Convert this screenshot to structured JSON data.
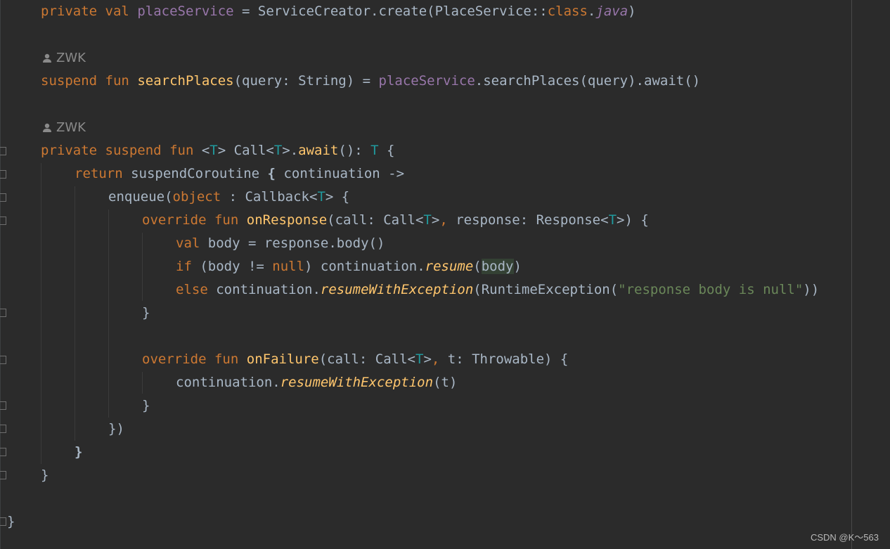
{
  "editor": {
    "colors": {
      "background": "#2b2b2b",
      "keyword": "#cc7832",
      "function": "#ffc66d",
      "property": "#9876aa",
      "type_param": "#20999d",
      "string": "#6a8759",
      "text": "#a9b7c6",
      "annotation": "#8a8a8a"
    },
    "author_hints": [
      "ZWK",
      "ZWK"
    ],
    "lines": {
      "l1": {
        "t1": "private",
        "t2": "val",
        "t3": "placeService",
        "t4": " = ServiceCreator.create(PlaceService::",
        "t5": "class",
        "t6": ".",
        "t7": "java",
        "t8": ")"
      },
      "l2": {
        "t1": "suspend",
        "t2": "fun",
        "t3": "searchPlaces",
        "t4": "(query: String) = ",
        "t5": "placeService",
        "t6": ".searchPlaces(query).await()"
      },
      "l3": {
        "t1": "private",
        "t2": "suspend",
        "t3": "fun",
        "t4": "<",
        "t5": "T",
        "t6": "> Call<",
        "t7": "T",
        "t8": ">.",
        "t9": "await",
        "t10": "(): ",
        "t11": "T",
        "t12": " {"
      },
      "l4": {
        "t1": "return",
        "t2": " suspendCoroutine ",
        "t3": "{",
        "t4": " continuation ->"
      },
      "l5": {
        "t1": "enqueue(",
        "t2": "object",
        "t3": " : Callback<",
        "t4": "T",
        "t5": "> {"
      },
      "l6": {
        "t1": "override",
        "t2": "fun",
        "t3": "onResponse",
        "t4": "(call: Call<",
        "t5": "T",
        "t6": ">",
        "t7": ", ",
        "t8": "response: Response<",
        "t9": "T",
        "t10": ">) {"
      },
      "l7": {
        "t1": "val",
        "t2": " body = response.body()"
      },
      "l8": {
        "t1": "if",
        "t2": " (body != ",
        "t3": "null",
        "t4": ") continuation.",
        "t5": "resume",
        "t6": "(",
        "t7": "body",
        "t8": ")"
      },
      "l9": {
        "t1": "else",
        "t2": " continuation.",
        "t3": "resumeWithException",
        "t4": "(RuntimeException(",
        "t5": "\"response body is null\"",
        "t6": "))"
      },
      "l10": {
        "t1": "}"
      },
      "l11": {
        "t1": "override",
        "t2": "fun",
        "t3": "onFailure",
        "t4": "(call: Call<",
        "t5": "T",
        "t6": ">",
        "t7": ", ",
        "t8": "t: Throwable) {"
      },
      "l12": {
        "t1": "continuation.",
        "t2": "resumeWithException",
        "t3": "(t)"
      },
      "l13": {
        "t1": "}"
      },
      "l14": {
        "t1": "})"
      },
      "l15": {
        "t1": "}"
      },
      "l16": {
        "t1": "}"
      },
      "l17": {
        "t1": "}"
      }
    }
  },
  "watermark": "CSDN @K～563"
}
